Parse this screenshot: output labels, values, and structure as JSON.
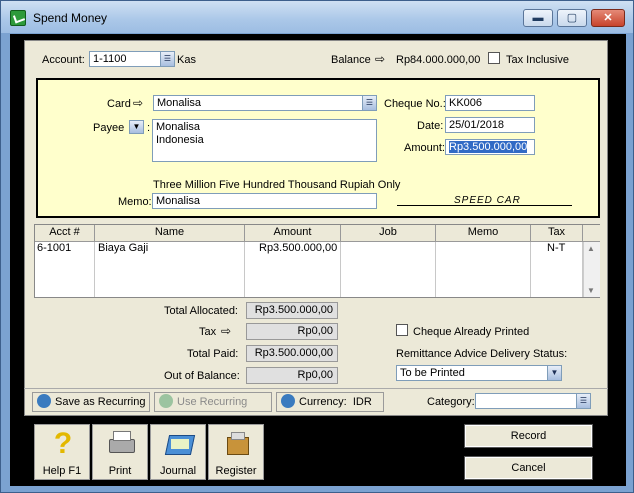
{
  "window": {
    "title": "Spend Money",
    "min_glyph": "▬",
    "max_glyph": "▢",
    "close_glyph": "✕"
  },
  "header": {
    "account_label": "Account:",
    "account_value": "1-1100",
    "account_name": "Kas",
    "balance_label": "Balance",
    "balance_value": "Rp84.000.000,00",
    "tax_inclusive_label": "Tax Inclusive"
  },
  "cheque": {
    "card_label": "Card",
    "card_value": "Monalisa",
    "payee_label": "Payee",
    "payee_lines": [
      "Monalisa",
      "Indonesia"
    ],
    "cheque_no_label": "Cheque No.:",
    "cheque_no_value": "KK006",
    "date_label": "Date:",
    "date_value": "25/01/2018",
    "amount_label": "Amount:",
    "amount_value": "Rp3.500.000,00",
    "amount_words": "Three Million Five Hundred Thousand Rupiah Only",
    "memo_label": "Memo:",
    "memo_value": "Monalisa",
    "signature": "SPEED CAR"
  },
  "table": {
    "columns": [
      "Acct #",
      "Name",
      "Amount",
      "Job",
      "Memo",
      "Tax"
    ],
    "rows": [
      {
        "acct": "6-1001",
        "name": "Biaya Gaji",
        "amount": "Rp3.500.000,00",
        "job": "",
        "memo": "",
        "tax": "N-T"
      }
    ]
  },
  "totals": {
    "allocated_label": "Total Allocated:",
    "allocated_value": "Rp3.500.000,00",
    "tax_label": "Tax",
    "tax_value": "Rp0,00",
    "paid_label": "Total Paid:",
    "paid_value": "Rp3.500.000,00",
    "oob_label": "Out of Balance:",
    "oob_value": "Rp0,00"
  },
  "options": {
    "cheque_printed_label": "Cheque Already Printed",
    "remittance_label": "Remittance Advice Delivery Status:",
    "remittance_value": "To be Printed"
  },
  "toolbar": {
    "save_recurring": "Save as Recurring",
    "use_recurring": "Use Recurring",
    "currency_label": "Currency:",
    "currency_value": "IDR",
    "category_label": "Category:"
  },
  "buttons": {
    "help": "Help F1",
    "print": "Print",
    "journal": "Journal",
    "register": "Register",
    "record": "Record",
    "cancel": "Cancel"
  },
  "colors": {
    "cheque_bg": "#ffffcc",
    "selection": "#316ac5",
    "title_bar": "#aac7e8"
  }
}
